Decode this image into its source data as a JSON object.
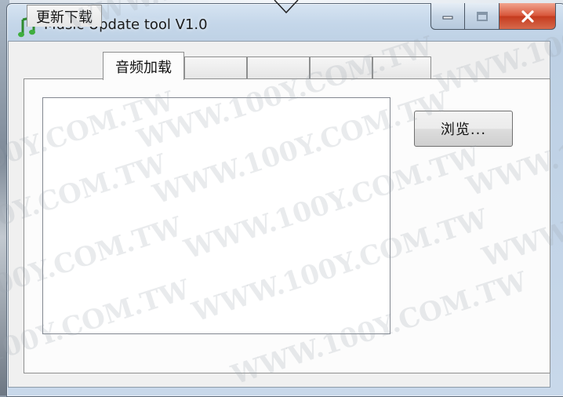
{
  "window": {
    "title": "Music Update tool V1.0",
    "icon": "music-note-icon"
  },
  "caption_buttons": {
    "minimize_icon": "minimize-icon",
    "maximize_icon": "maximize-icon",
    "close_icon": "close-icon"
  },
  "tabs": [
    {
      "label": "更新下载",
      "selected": false
    },
    {
      "label": "音频加载",
      "selected": true
    },
    {
      "label": "",
      "selected": false
    },
    {
      "label": "",
      "selected": false
    },
    {
      "label": "",
      "selected": false
    },
    {
      "label": "",
      "selected": false
    }
  ],
  "panel": {
    "browse_label": "浏览..."
  },
  "watermark": {
    "text": "WWW.100Y.COM.TW"
  },
  "colors": {
    "close_red": "#c53b1f",
    "title_glass": "#c4d6e9",
    "face": "#f0f0f0"
  }
}
